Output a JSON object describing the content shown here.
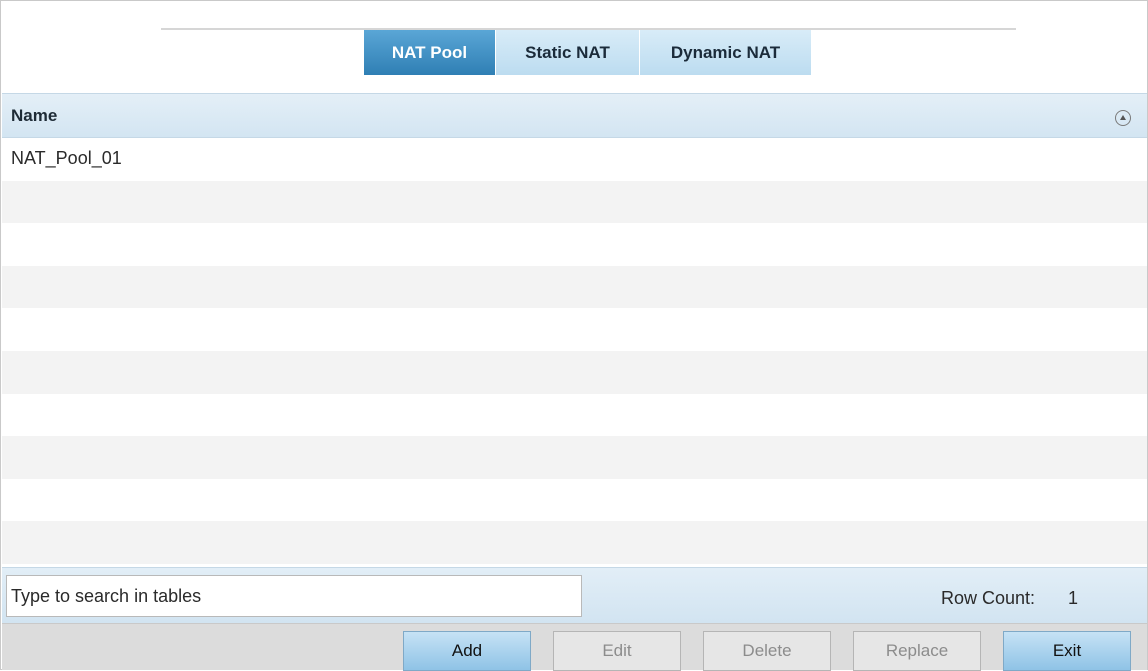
{
  "tabs": [
    {
      "label": "NAT Pool",
      "active": true
    },
    {
      "label": "Static NAT",
      "active": false
    },
    {
      "label": "Dynamic NAT",
      "active": false
    }
  ],
  "table": {
    "columns": [
      "Name"
    ],
    "rows": [
      [
        "NAT_Pool_01"
      ]
    ]
  },
  "search": {
    "placeholder": "Type to search in tables",
    "value": ""
  },
  "row_count": {
    "label": "Row Count:",
    "value": "1"
  },
  "buttons": {
    "add": "Add",
    "edit": "Edit",
    "delete": "Delete",
    "replace": "Replace",
    "exit": "Exit"
  },
  "colors": {
    "active_tab": "#3a8cc2",
    "inactive_tab": "#c7e3f3",
    "header_bg": "#dceaf4",
    "button_enabled": "#a8d2ee"
  }
}
